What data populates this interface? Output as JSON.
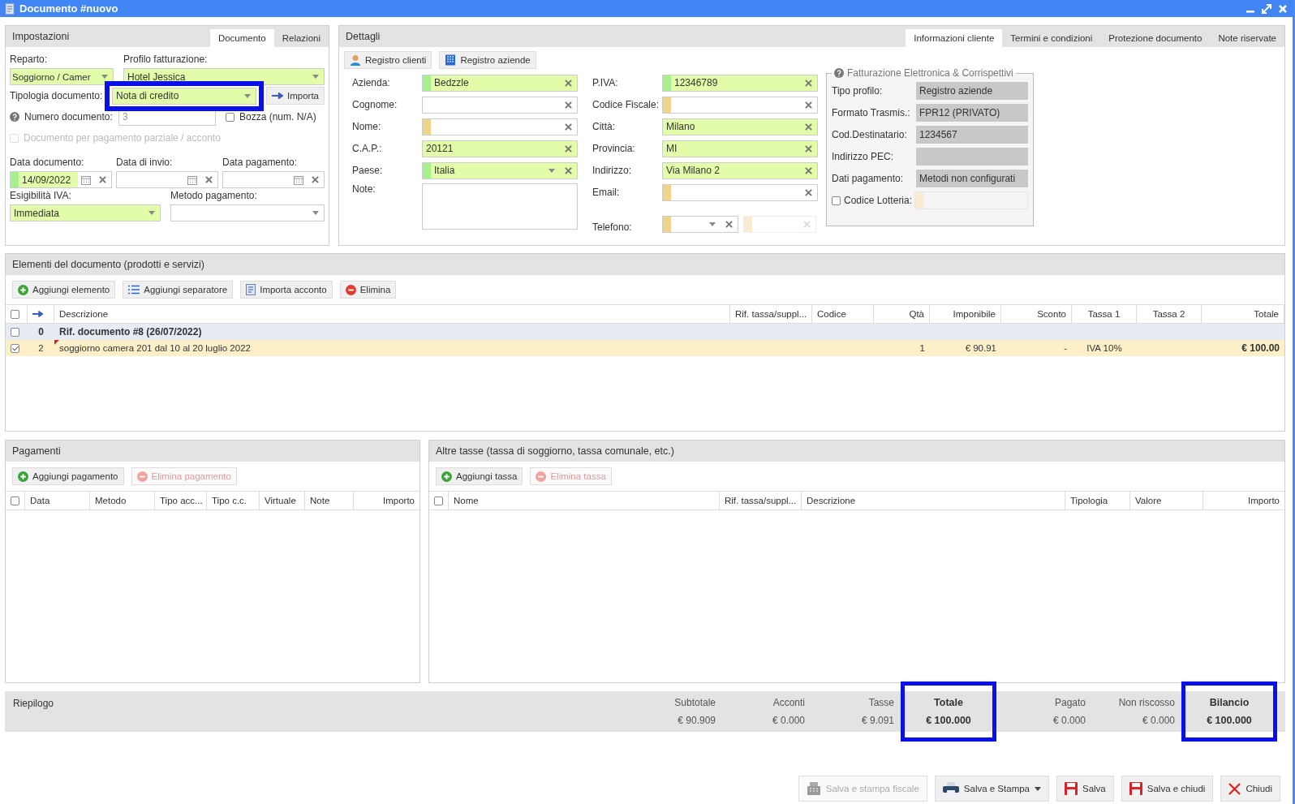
{
  "window": {
    "title": "Documento #nuovo"
  },
  "settings": {
    "title": "Impostazioni",
    "tabs": [
      {
        "label": "Documento",
        "selected": true
      },
      {
        "label": "Relazioni",
        "selected": false
      }
    ],
    "reparto": {
      "label": "Reparto:",
      "value": "Soggiorno / Camer"
    },
    "profilo": {
      "label": "Profilo fatturazione:",
      "value": "Hotel Jessica"
    },
    "tipologia": {
      "label": "Tipologia documento:",
      "value": "Nota di credito",
      "highlighted": true
    },
    "import_button": "Importa",
    "numero": {
      "label": "Numero documento:",
      "value": "3",
      "readonly": true
    },
    "bozza": {
      "label": "Bozza (num. N/A)",
      "checked": false
    },
    "acconto": {
      "label": "Documento per pagamento parziale / acconto",
      "checked": false,
      "disabled": true
    },
    "dates": [
      {
        "label": "Data documento:",
        "value": "14/09/2022",
        "color": "#a8f08e"
      },
      {
        "label": "Data di invio:"
      },
      {
        "label": "Data pagamento:"
      }
    ],
    "esigibilita": {
      "label": "Esigibilità IVA:",
      "value": "Immediata"
    },
    "metodo": {
      "label": "Metodo pagamento:"
    }
  },
  "details": {
    "title": "Dettagli",
    "tabs": [
      {
        "label": "Informazioni cliente",
        "selected": true
      },
      {
        "label": "Termini e condizioni",
        "selected": false
      },
      {
        "label": "Protezione documento",
        "selected": false
      },
      {
        "label": "Note riservate",
        "selected": false
      }
    ],
    "buttons": [
      {
        "label": "Registro clienti",
        "kind": "person"
      },
      {
        "label": "Registro aziende",
        "kind": "building"
      }
    ],
    "left_fields": [
      {
        "label": "Azienda:",
        "value": "Bedzzle",
        "color": "#a8f08e",
        "kind": "text"
      },
      {
        "label": "Cognome:",
        "kind": "text"
      },
      {
        "label": "Nome:",
        "color": "#f0d48c",
        "kind": "text"
      },
      {
        "label": "C.A.P.:",
        "value": "20121",
        "kind": "text"
      },
      {
        "label": "Paese:",
        "value": "Italia",
        "color": "#a8f08e",
        "kind": "select"
      },
      {
        "label": "Note:",
        "kind": "textarea"
      }
    ],
    "right_fields": [
      {
        "label": "P.IVA:",
        "value": "12346789",
        "color": "#a8f08e",
        "kind": "text"
      },
      {
        "label": "Codice Fiscale:",
        "color": "#f0d48c",
        "kind": "text"
      },
      {
        "label": "Città:",
        "value": "Milano",
        "kind": "text"
      },
      {
        "label": "Provincia:",
        "value": "MI",
        "kind": "text"
      },
      {
        "label": "Indirizzo:",
        "value": "Via Milano 2",
        "kind": "text"
      },
      {
        "label": "Email:",
        "color": "#f0d48c",
        "kind": "text"
      },
      {
        "label": "Telefono:",
        "color": "#f0d48c",
        "kind": "phone"
      }
    ],
    "einvoice": {
      "title": "Fatturazione Elettronica & Corrispettivi",
      "rows": [
        {
          "label": "Tipo profilo:",
          "value": "Registro aziende"
        },
        {
          "label": "Formato Trasmis.:",
          "value": "FPR12 (PRIVATO)"
        },
        {
          "label": "Cod.Destinatario:",
          "value": "1234567"
        },
        {
          "label": "Indirizzo PEC:"
        },
        {
          "label": "Dati pagamento:",
          "value": "Metodi non configurati"
        }
      ],
      "lotteria": {
        "label": "Codice Lotteria:",
        "checked": false
      }
    }
  },
  "items": {
    "title": "Elementi del documento (prodotti e servizi)",
    "header_checked": false,
    "toolbar": [
      {
        "label": "Aggiungi elemento",
        "kind": "plus",
        "disabled": false
      },
      {
        "label": "Aggiungi separatore",
        "kind": "list",
        "disabled": false
      },
      {
        "label": "Importa acconto",
        "kind": "document",
        "disabled": false
      },
      {
        "label": "Elimina",
        "kind": "minus",
        "disabled": false
      }
    ],
    "columns": [
      "Descrizione",
      "Rif. tassa/suppl...",
      "Codice",
      "Qtà",
      "Imponibile",
      "Sconto",
      "Tassa 1",
      "Tassa 2",
      "Totale"
    ],
    "rows": [
      {
        "kind": "group",
        "checked": false,
        "index": "0",
        "description": "Rif. documento #8 (26/07/2022)"
      },
      {
        "kind": "item",
        "checked": true,
        "index": "2",
        "description": "soggiorno camera 201 dal 10 al 20 luglio 2022",
        "quantity": "1",
        "taxable": "€ 90.91",
        "discount": "-",
        "tax_1": "IVA 10%",
        "total": "€ 100.00"
      }
    ]
  },
  "payments": {
    "title": "Pagamenti",
    "header_checked": false,
    "toolbar": [
      {
        "label": "Aggiungi pagamento",
        "kind": "plus",
        "disabled": false
      },
      {
        "label": "Elimina pagamento",
        "kind": "minus",
        "disabled": true
      }
    ],
    "columns": [
      "Data",
      "Metodo",
      "Tipo acc...",
      "Tipo c.c.",
      "Virtuale",
      "Note",
      "Importo"
    ]
  },
  "other_taxes": {
    "title": "Altre tasse (tassa di soggiorno, tassa comunale, etc.)",
    "header_checked": false,
    "toolbar": [
      {
        "label": "Aggiungi tassa",
        "kind": "plus",
        "disabled": false
      },
      {
        "label": "Elimina tassa",
        "kind": "minus",
        "disabled": true
      }
    ],
    "columns": [
      "Nome",
      "Rif. tassa/suppl...",
      "Descrizione",
      "Tipologia",
      "Valore",
      "Importo"
    ]
  },
  "summary": {
    "title": "Riepilogo",
    "columns": [
      {
        "label": "Subtotale",
        "value": "€ 90.909",
        "highlighted": false
      },
      {
        "label": "Acconti",
        "value": "€ 0.000",
        "highlighted": false
      },
      {
        "label": "Tasse",
        "value": "€ 9.091",
        "highlighted": false
      },
      {
        "label": "Totale",
        "value": "€ 100.000",
        "highlighted": true
      },
      {
        "label": "Pagato",
        "value": "€ 0.000",
        "highlighted": false
      },
      {
        "label": "Non riscosso",
        "value": "€ 0.000",
        "highlighted": false
      },
      {
        "label": "Bilancio",
        "value": "€ 100.000",
        "highlighted": true
      }
    ]
  },
  "footer_buttons": [
    {
      "label": "Salva e stampa fiscale",
      "kind": "register",
      "disabled": true,
      "dropdown": false
    },
    {
      "label": "Salva e Stampa",
      "kind": "printer",
      "disabled": false,
      "dropdown": true
    },
    {
      "label": "Salva",
      "kind": "floppy",
      "disabled": false,
      "dropdown": false
    },
    {
      "label": "Salva e chiudi",
      "kind": "floppy",
      "disabled": false,
      "dropdown": false
    },
    {
      "label": "Chiudi",
      "kind": "cross",
      "disabled": false,
      "dropdown": false
    }
  ]
}
